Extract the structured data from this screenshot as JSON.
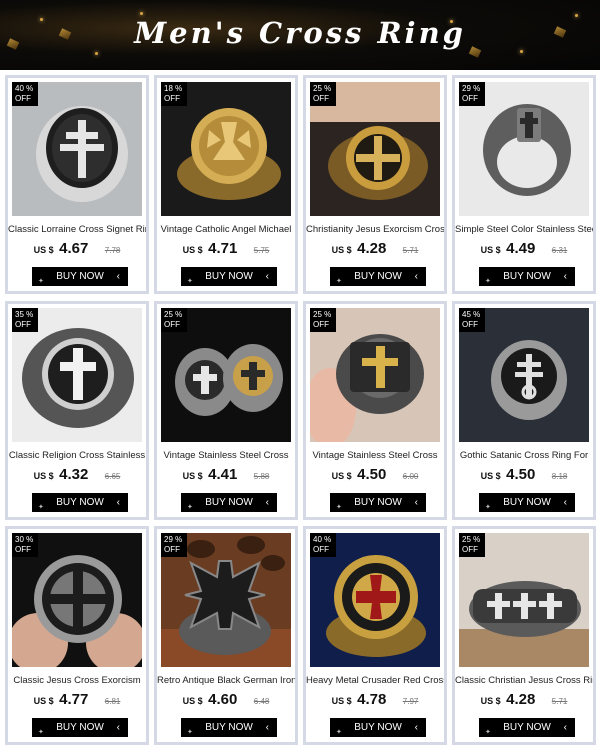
{
  "banner": {
    "title": "Men's Cross Ring"
  },
  "products": [
    {
      "discount": "40 %",
      "off": "OFF",
      "name": "Classic Lorraine Cross Signet Ring",
      "currency": "US $",
      "price": "4.67",
      "old_price": "7.78",
      "buy": "BUY NOW"
    },
    {
      "discount": "18 %",
      "off": "OFF",
      "name": "Vintage Catholic Angel Michael",
      "currency": "US $",
      "price": "4.71",
      "old_price": "5.75",
      "buy": "BUY NOW"
    },
    {
      "discount": "25 %",
      "off": "OFF",
      "name": "Christianity Jesus Exorcism Cross",
      "currency": "US $",
      "price": "4.28",
      "old_price": "5.71",
      "buy": "BUY NOW"
    },
    {
      "discount": "29 %",
      "off": "OFF",
      "name": "Simple Steel Color Stainless Steel",
      "currency": "US $",
      "price": "4.49",
      "old_price": "6.31",
      "buy": "BUY NOW"
    },
    {
      "discount": "35 %",
      "off": "OFF",
      "name": "Classic Religion Cross Stainless",
      "currency": "US $",
      "price": "4.32",
      "old_price": "6.65",
      "buy": "BUY NOW"
    },
    {
      "discount": "25 %",
      "off": "OFF",
      "name": "Vintage Stainless Steel Cross",
      "currency": "US $",
      "price": "4.41",
      "old_price": "5.88",
      "buy": "BUY NOW"
    },
    {
      "discount": "25 %",
      "off": "OFF",
      "name": "Vintage Stainless Steel Cross",
      "currency": "US $",
      "price": "4.50",
      "old_price": "6.00",
      "buy": "BUY NOW"
    },
    {
      "discount": "45 %",
      "off": "OFF",
      "name": "Gothic Satanic Cross Ring For",
      "currency": "US $",
      "price": "4.50",
      "old_price": "8.18",
      "buy": "BUY NOW"
    },
    {
      "discount": "30 %",
      "off": "OFF",
      "name": "Classic Jesus Cross Exorcism",
      "currency": "US $",
      "price": "4.77",
      "old_price": "6.81",
      "buy": "BUY NOW"
    },
    {
      "discount": "29 %",
      "off": "OFF",
      "name": "Retro Antique Black German Iron",
      "currency": "US $",
      "price": "4.60",
      "old_price": "6.48",
      "buy": "BUY NOW"
    },
    {
      "discount": "40 %",
      "off": "OFF",
      "name": "Heavy Metal Crusader Red Cross",
      "currency": "US $",
      "price": "4.78",
      "old_price": "7.97",
      "buy": "BUY NOW"
    },
    {
      "discount": "25 %",
      "off": "OFF",
      "name": "Classic Christian Jesus Cross Ring",
      "currency": "US $",
      "price": "4.28",
      "old_price": "5.71",
      "buy": "BUY NOW"
    }
  ],
  "photo_style": [
    {
      "bg": "#b9bcbf",
      "ring": "#2a2a2a",
      "accent": "#e8e8e8",
      "icon": "lorraine-cross-icon"
    },
    {
      "bg": "#1a1a1a",
      "ring": "#c8a24a",
      "accent": "#6e5520",
      "icon": "angel-michael-icon"
    },
    {
      "bg": "#2b2420",
      "ring": "#c79a3c",
      "accent": "#2a1a08",
      "icon": "benedict-cross-icon"
    },
    {
      "bg": "#e9e9e9",
      "ring": "#6d6d6d",
      "accent": "#2d2d2d",
      "icon": "cross-icon"
    },
    {
      "bg": "#ececec",
      "ring": "#3a3a3a",
      "accent": "#f2f2f2",
      "icon": "cross-icon"
    },
    {
      "bg": "#0e0e0e",
      "ring": "#3c3c3c",
      "accent": "#e0e0e0",
      "icon": "cross-icon"
    },
    {
      "bg": "#d7c6b8",
      "ring": "#5a5a5a",
      "accent": "#d8b24a",
      "icon": "cross-icon"
    },
    {
      "bg": "#2a2f38",
      "ring": "#3a3a3a",
      "accent": "#d8d8d8",
      "icon": "leviathan-cross-icon"
    },
    {
      "bg": "#101010",
      "ring": "#8a8a8a",
      "accent": "#1a1a1a",
      "icon": "benedict-cross-icon"
    },
    {
      "bg": "#6a3d22",
      "ring": "#303030",
      "accent": "#1c1c1c",
      "icon": "iron-cross-icon"
    },
    {
      "bg": "#0f1e4a",
      "ring": "#b08a32",
      "accent": "#a01818",
      "icon": "crusader-cross-icon"
    },
    {
      "bg": "#d9d1c8",
      "ring": "#4a4a4a",
      "accent": "#e6e6e6",
      "icon": "cross-icon"
    }
  ]
}
